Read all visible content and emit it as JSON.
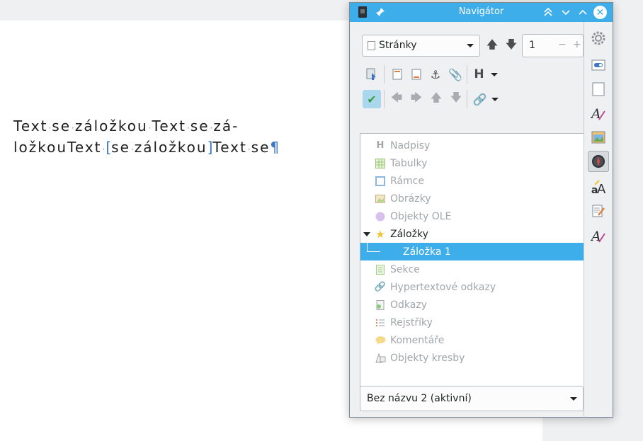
{
  "document": {
    "line1": [
      "Text",
      "se",
      "záložkou",
      "Text",
      "se",
      "zá-"
    ],
    "line2_a": "ložkouText",
    "line2_b": [
      "se",
      "záložkou"
    ],
    "line2_c": [
      "Text",
      "se"
    ],
    "pilcrow": "¶",
    "bookmark_open": "[",
    "bookmark_close": "]"
  },
  "navigator": {
    "title": "Navigátor",
    "category_select": "Stránky",
    "page_number": "1",
    "spin_minus": "−",
    "spin_plus": "+",
    "tree": [
      {
        "label": "Nadpisy",
        "icon": "heading-icon",
        "state": "disabled"
      },
      {
        "label": "Tabulky",
        "icon": "table-icon",
        "state": "disabled"
      },
      {
        "label": "Rámce",
        "icon": "frame-icon",
        "state": "disabled"
      },
      {
        "label": "Obrázky",
        "icon": "image-icon",
        "state": "disabled"
      },
      {
        "label": "Objekty OLE",
        "icon": "ole-object-icon",
        "state": "disabled"
      },
      {
        "label": "Záložky",
        "icon": "star-icon",
        "state": "expanded"
      },
      {
        "label": "Záložka 1",
        "icon": "none",
        "state": "selected"
      },
      {
        "label": "Sekce",
        "icon": "section-icon",
        "state": "disabled"
      },
      {
        "label": "Hypertextové odkazy",
        "icon": "hyperlink-icon",
        "state": "disabled"
      },
      {
        "label": "Odkazy",
        "icon": "reference-icon",
        "state": "disabled"
      },
      {
        "label": "Rejstříky",
        "icon": "index-icon",
        "state": "disabled"
      },
      {
        "label": "Komentáře",
        "icon": "comment-icon",
        "state": "disabled"
      },
      {
        "label": "Objekty kresby",
        "icon": "drawing-object-icon",
        "state": "disabled"
      }
    ],
    "document_select": "Bez názvu 2 (aktivní)"
  },
  "colors": {
    "titlebar": "#3daee9",
    "selection": "#3daee9",
    "window_bg": "#eff0f1"
  }
}
